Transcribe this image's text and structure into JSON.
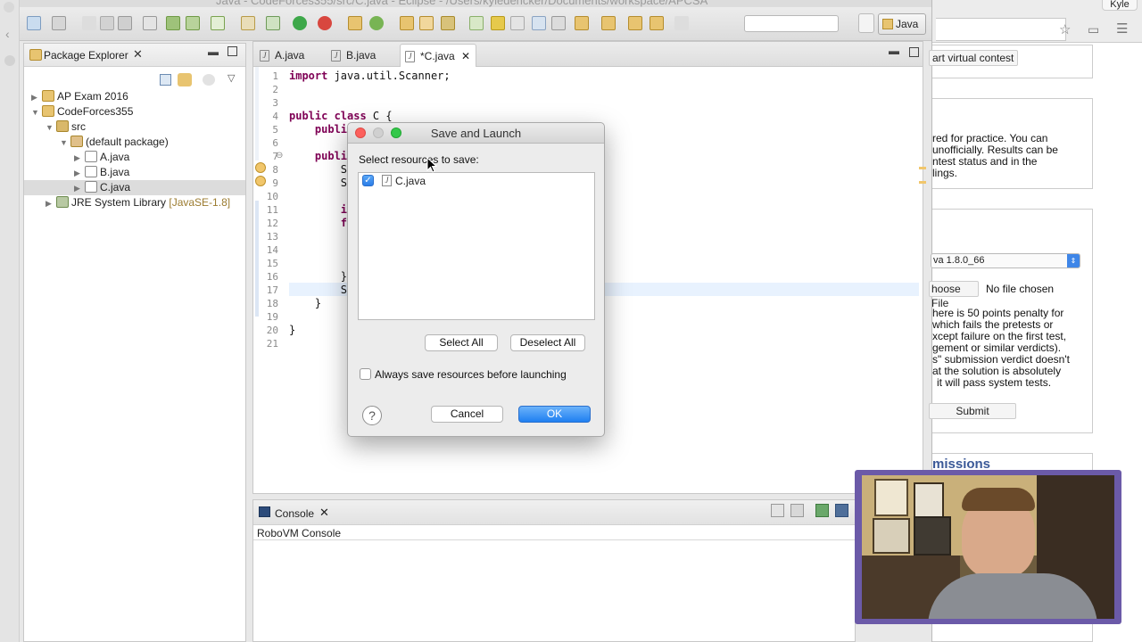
{
  "window": {
    "title": "Java - CodeForces355/src/C.java - Eclipse - /Users/kyledencker/Documents/workspace/APCSA"
  },
  "toolbar": {
    "perspective_label": "Java"
  },
  "package_explorer": {
    "title": "Package Explorer",
    "tree": [
      {
        "label": "AP Exam 2016"
      },
      {
        "label": "CodeForces355"
      },
      {
        "label": "src"
      },
      {
        "label": "(default package)"
      },
      {
        "label": "A.java"
      },
      {
        "label": "B.java"
      },
      {
        "label": "C.java"
      },
      {
        "label": "JRE System Library",
        "suffix": "[JavaSE-1.8]"
      }
    ]
  },
  "editor": {
    "tabs": [
      {
        "label": "A.java"
      },
      {
        "label": "B.java"
      },
      {
        "label": "*C.java"
      }
    ],
    "line_numbers": [
      "1",
      "2",
      "3",
      "4",
      "5",
      "6",
      "7",
      "8",
      "9",
      "10",
      "11",
      "12",
      "13",
      "14",
      "15",
      "16",
      "17",
      "18",
      "19",
      "20",
      "21"
    ],
    "code": {
      "l1_kw": "import",
      "l1_rest": " java.util.Scanner;",
      "l4_kw": "public class",
      "l4_rest": " C {",
      "l5": "    public",
      "l7": "    public",
      "l8": "        Sc",
      "l9": "        St",
      "l11": "        in",
      "l12": "        fo",
      "l16": "        }",
      "l17": "        Sy",
      "l18": "    }",
      "l20": "}"
    }
  },
  "console": {
    "title": "Console",
    "subtitle": "RoboVM Console"
  },
  "dialog": {
    "title": "Save and Launch",
    "prompt": "Select resources to save:",
    "resources": [
      {
        "label": "C.java",
        "checked": true
      }
    ],
    "select_all": "Select All",
    "deselect_all": "Deselect All",
    "always_save": "Always save resources before launching",
    "cancel": "Cancel",
    "ok": "OK",
    "help": "?"
  },
  "browser": {
    "user": "Kyle",
    "virtual_contest": "art virtual contest",
    "practice_text": [
      "red for practice. You can",
      "unofficially. Results can be",
      "ntest status and in the",
      "lings."
    ],
    "language": "va 1.8.0_66",
    "choose_file": "hoose File",
    "no_file": "No file chosen",
    "penalty_text": [
      "here is 50 points penalty for",
      "which fails the pretests or",
      "xcept failure on the first test,",
      "gement or similar verdicts).",
      "s\" submission verdict doesn't",
      "at the solution is absolutely",
      "it will pass system tests."
    ],
    "submit": "Submit",
    "submissions_heading": "missions"
  },
  "colors": {
    "accent_blue": "#1f7ff1",
    "keyword_purple": "#7f0055",
    "close_red": "#fc605c",
    "webcam_border": "#6b5aa8"
  }
}
